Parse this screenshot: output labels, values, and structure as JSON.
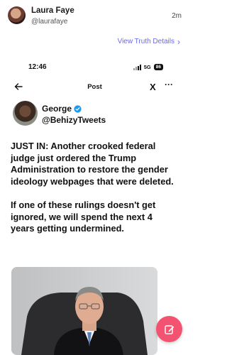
{
  "post": {
    "author_name": "Laura Faye",
    "author_handle": "@laurafaye",
    "time": "2m",
    "view_details": "View Truth Details",
    "view_details_chevron": "›"
  },
  "screenshot": {
    "status": {
      "time": "12:46",
      "network": "5G",
      "battery": "86"
    },
    "nav": {
      "title": "Post",
      "logo": "X",
      "more": "···",
      "back_icon": "arrow-left-icon"
    },
    "tweet": {
      "author_name": "George",
      "author_handle": "@BehizyTweets",
      "verified_icon": "verified-badge-icon",
      "paragraphs": [
        "JUST IN: Another crooked federal judge just ordered the Trump Administration to restore the gender ideology webpages that were deleted.",
        "If one of these rulings doesn't get ignored, we will spend the next 4 years getting undermined."
      ]
    }
  },
  "compose": {
    "icon": "compose-icon"
  },
  "colors": {
    "accent": "#6d6ae0",
    "compose": "#f35370",
    "verified": "#1d9bf0"
  }
}
